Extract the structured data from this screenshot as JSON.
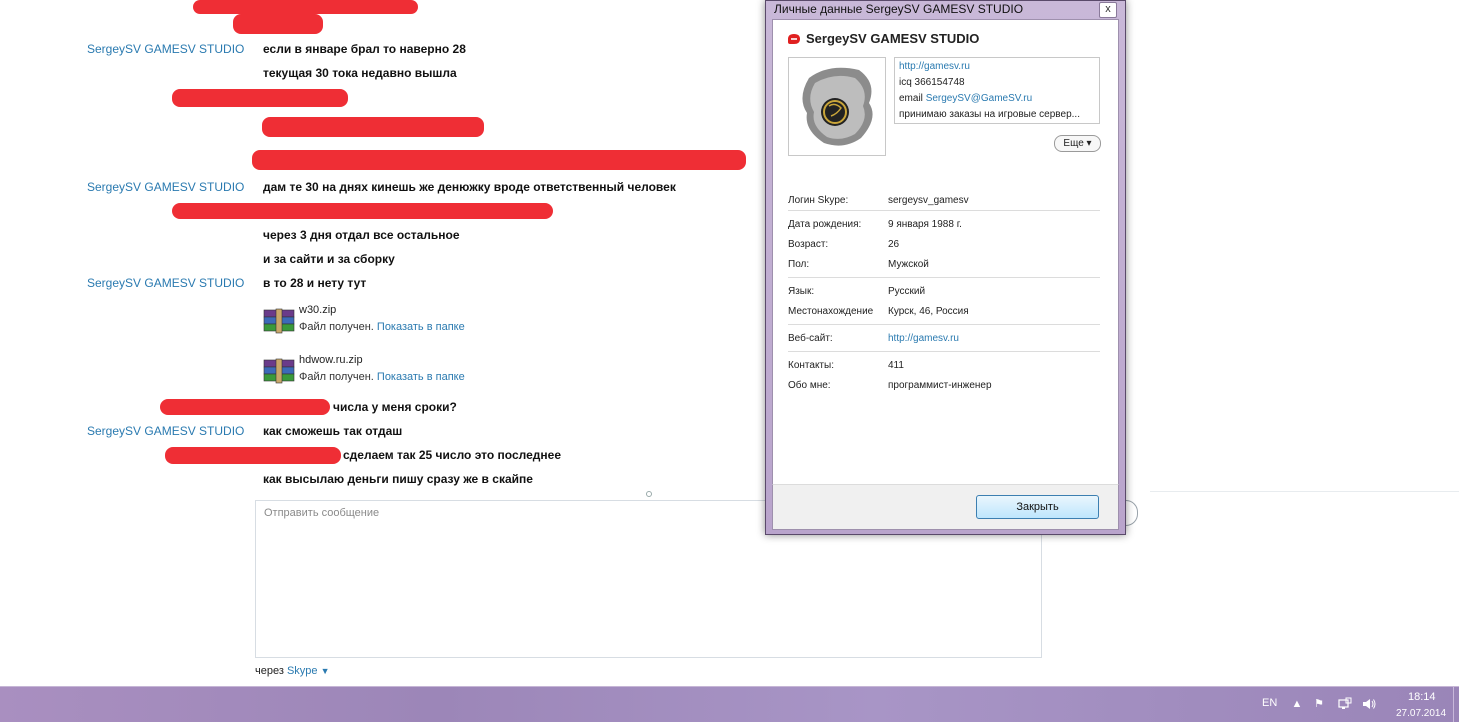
{
  "chat": {
    "messages": [
      {
        "sender": "SergeySV GAMESV STUDIO",
        "text": "если в январе брал то наверно 28"
      },
      {
        "sender": "",
        "text": "текущая 30 тока недавно вышла"
      },
      {
        "sender": "SergeySV GAMESV STUDIO",
        "text": "дам те 30 на днях кинешь же денюжку вроде ответственный человек"
      },
      {
        "sender": "",
        "text": "через 3 дня отдал все остальное"
      },
      {
        "sender": "",
        "text": "и за сайти и за сборку"
      },
      {
        "sender": "SergeySV GAMESV STUDIO",
        "text": "в то 28 и нету тут"
      },
      {
        "sender": "",
        "text": "числа у меня сроки?"
      },
      {
        "sender": "SergeySV GAMESV STUDIO",
        "text": "как сможешь так отдаш"
      },
      {
        "sender": "",
        "text": "сделаем так 25 число это последнее"
      },
      {
        "sender": "",
        "text": "как высылаю деньги пишу сразу же в скайпе"
      }
    ],
    "files": [
      {
        "name": "w30.zip",
        "status": "Файл получен.",
        "link": "Показать в папке",
        "icon": "winrar-archive-icon"
      },
      {
        "name": "hdwow.ru.zip",
        "status": "Файл получен.",
        "link": "Показать в папке",
        "icon": "winrar-archive-icon"
      }
    ],
    "compose_placeholder": "Отправить сообщение",
    "via_prefix": "через",
    "via_service": "Skype"
  },
  "dialog": {
    "title": "Личные данные SergeySV GAMESV STUDIO",
    "profile_name": "SergeySV GAMESV STUDIO",
    "mood": {
      "line1": "http://gamesv.ru",
      "line2": "icq 366154748",
      "line3_prefix": "email",
      "line3_link": "SergeySV@GameSV.ru",
      "line4": "принимаю заказы на игровые сервер..."
    },
    "more_label": "Еще",
    "fields": {
      "skype_login_label": "Логин Skype:",
      "skype_login": "sergeysv_gamesv",
      "birthday_label": "Дата рождения:",
      "birthday": "9 января 1988 г.",
      "age_label": "Возраст:",
      "age": "26",
      "sex_label": "Пол:",
      "sex": "Мужской",
      "language_label": "Язык:",
      "language": "Русский",
      "location_label": "Местонахождение",
      "location": "Курск, 46, Россия",
      "website_label": "Веб-сайт:",
      "website": "http://gamesv.ru",
      "contacts_label": "Контакты:",
      "contacts": "411",
      "about_label": "Обо мне:",
      "about": "программист-инженер"
    },
    "close_button": "Закрыть",
    "close_x": "x"
  },
  "taskbar": {
    "lang": "EN",
    "time": "18:14",
    "date": "27.07.2014"
  },
  "colors": {
    "link": "#2a7ab0",
    "redaction": "#ee1c24",
    "taskbar": "#a98fc0"
  }
}
